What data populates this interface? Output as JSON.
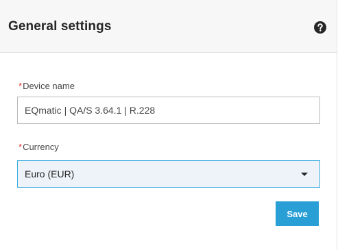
{
  "header": {
    "title": "General settings",
    "help_icon": "help-circle-icon"
  },
  "form": {
    "device_name": {
      "required_marker": "*",
      "label": "Device name",
      "value": "EQmatic | QA/S 3.64.1 | R.228"
    },
    "currency": {
      "required_marker": "*",
      "label": "Currency",
      "selected": "Euro (EUR)",
      "dropdown_icon": "caret-down-icon"
    },
    "save_label": "Save"
  },
  "colors": {
    "accent": "#2a9fd6",
    "focus_border": "#3dade0",
    "required": "#e12e2e",
    "header_bg": "#f7f7f7"
  }
}
